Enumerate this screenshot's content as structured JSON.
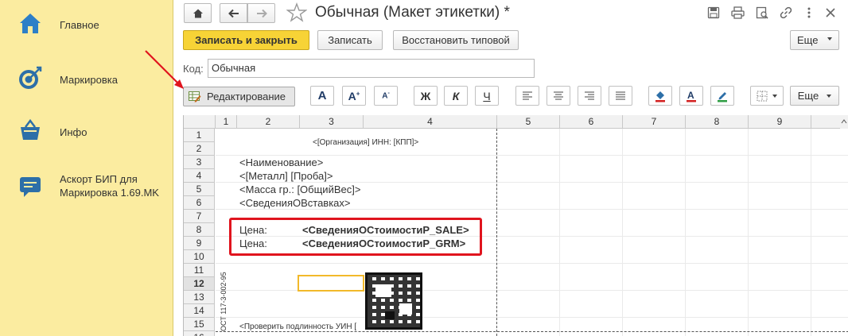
{
  "sidebar": {
    "items": [
      {
        "label": "Главное",
        "icon": "home-icon"
      },
      {
        "label": "Маркировка",
        "icon": "target-icon"
      },
      {
        "label": "Инфо",
        "icon": "basket-icon"
      },
      {
        "label": "Аскорт БИП для Маркировка 1.69.MK",
        "icon": "chat-icon"
      }
    ]
  },
  "window": {
    "title": "Обычная (Макет этикетки) *"
  },
  "toolbar": {
    "save_close": "Записать и закрыть",
    "save": "Записать",
    "restore": "Восстановить типовой",
    "more": "Еще"
  },
  "code": {
    "label": "Код:",
    "value": "Обычная"
  },
  "format_toolbar": {
    "edit_label": "Редактирование",
    "bold": "Ж",
    "italic": "К",
    "underline": "Ч",
    "more": "Еще"
  },
  "sheet": {
    "columns": [
      "1",
      "2",
      "3",
      "4",
      "5",
      "6",
      "7",
      "8",
      "9"
    ],
    "rows": [
      "1",
      "2",
      "3",
      "4",
      "5",
      "6",
      "7",
      "8",
      "9",
      "10",
      "11",
      "12",
      "13",
      "14",
      "15",
      "16"
    ],
    "org_line": "<[Организация] ИНН: [КПП]>",
    "name_line": "<Наименование>",
    "metal_line": "<[Металл] [Проба]>",
    "mass_line": "<Масса гр.: [ОбщийВес]>",
    "inserts_line": "<СведенияОВставках>",
    "price1_label": "Цена:",
    "price1_value": "<СведенияОСтоимостиР_SALE>",
    "price2_label": "Цена:",
    "price2_value": "<СведенияОСтоимостиР_GRM>",
    "vertical_text": "ОСТ 117-3-002-95",
    "verify_line": "<Проверить подлинность УИН [",
    "highlight_color": "#e0141e",
    "accent_color": "#f7d336"
  }
}
